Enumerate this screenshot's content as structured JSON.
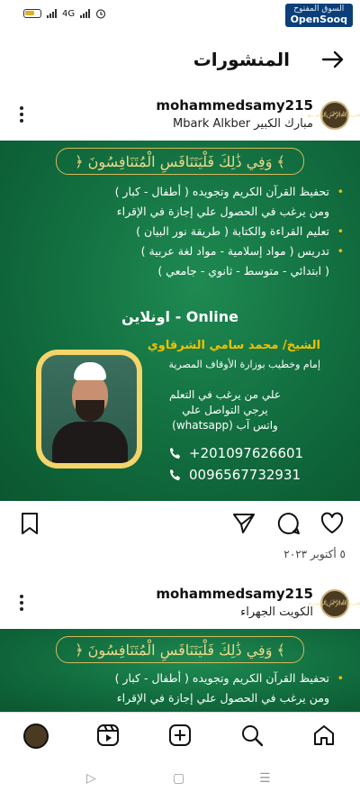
{
  "status_bar": {
    "network": "4G",
    "badge_ar": "السوق المفتوح",
    "badge_en": "OpenSooq"
  },
  "header": {
    "title": "المنشورات",
    "back_icon": "arrow-right-icon"
  },
  "posts": [
    {
      "username": "mohammedsamy215",
      "location": "Mbark Alkber مبارك الكبير",
      "date": "٥ أكتوبر ٢٠٢٣"
    },
    {
      "username": "mohammedsamy215",
      "location": "الكويت الجهراء"
    }
  ],
  "poster": {
    "verse": "﴿ وَفِي ذَٰلِكَ فَلْيَتَنَافَسِ الْمُتَنَافِسُونَ ﴾",
    "lines": [
      "تحفيظ القرآن الكريم وتجويده ( أطفال - كبار )",
      "ومن يرغب في الحصول علي إجازة في الإقراء",
      "تعليم القراءة والكتابة ( طريقة نور البيان )",
      "تدريس ( مواد إسلامية - مواد لغة عربية )",
      "( ابتدائي - متوسط - ثانوي - جامعي )"
    ],
    "online": "اونلاين - Online",
    "sheikh": "الشيخ/ محمد سامي الشرقاوي",
    "role": "إمام وخطيب بوزارة الأوقاف المصرية",
    "contact_1": "علي من يرغب في التعلم",
    "contact_2": "يرجي التواصل علي",
    "contact_3": "واتس آب (whatsapp)",
    "phone_1": "+201097626601",
    "phone_2": "0096567732931"
  },
  "actions": {
    "like_icon": "heart-icon",
    "comment_icon": "comment-icon",
    "share_icon": "send-icon",
    "save_icon": "bookmark-icon"
  },
  "bottom_nav": [
    "home-icon",
    "search-icon",
    "add-post-icon",
    "reels-icon",
    "profile-icon"
  ]
}
